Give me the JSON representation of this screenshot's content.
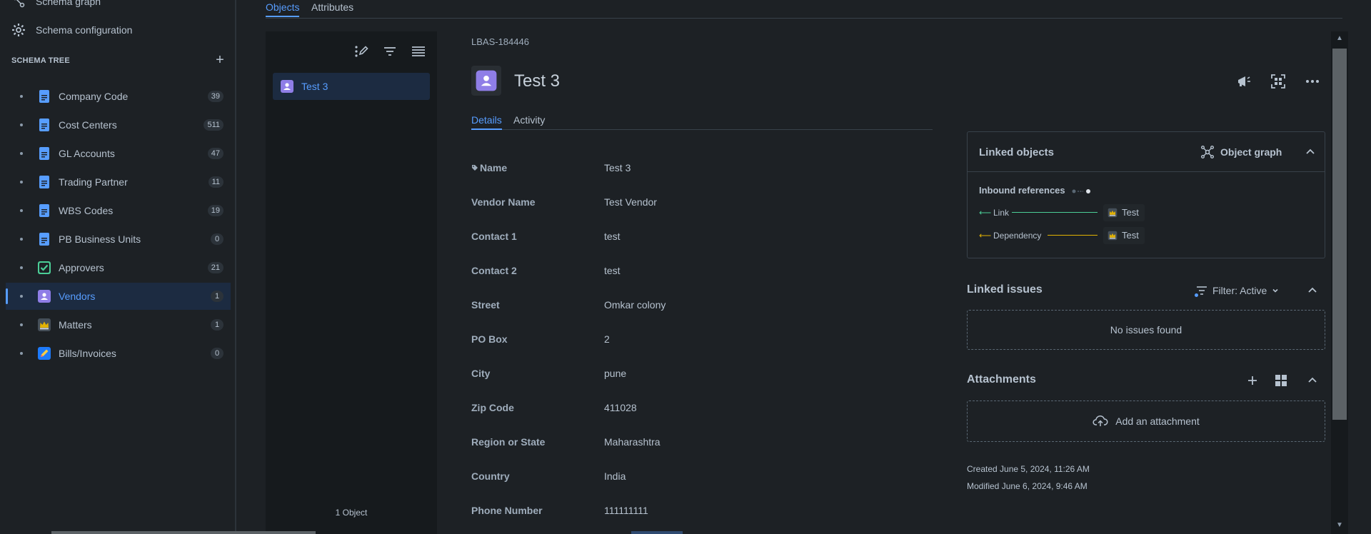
{
  "sidebar": {
    "top_item_partial": "Schema graph",
    "schema_config_label": "Schema configuration",
    "tree_header": "SCHEMA TREE",
    "items": [
      {
        "label": "Company Code",
        "count": "39",
        "icon": "document-icon",
        "color": "#579dff"
      },
      {
        "label": "Cost Centers",
        "count": "511",
        "icon": "document-icon",
        "color": "#579dff"
      },
      {
        "label": "GL Accounts",
        "count": "47",
        "icon": "document-icon",
        "color": "#579dff"
      },
      {
        "label": "Trading Partner",
        "count": "11",
        "icon": "document-icon",
        "color": "#579dff"
      },
      {
        "label": "WBS Codes",
        "count": "19",
        "icon": "document-icon",
        "color": "#579dff"
      },
      {
        "label": "PB Business Units",
        "count": "0",
        "icon": "document-icon",
        "color": "#579dff"
      },
      {
        "label": "Approvers",
        "count": "21",
        "icon": "checkbox-icon",
        "color": "#4bce97"
      },
      {
        "label": "Vendors",
        "count": "1",
        "icon": "person-icon",
        "color": "#8f7ee7"
      },
      {
        "label": "Matters",
        "count": "1",
        "icon": "crown-icon",
        "color": "#454f59"
      },
      {
        "label": "Bills/Invoices",
        "count": "0",
        "icon": "pencil-icon",
        "color": "#1d7afc"
      }
    ]
  },
  "top_tabs": {
    "objects": "Objects",
    "attributes": "Attributes"
  },
  "object_list": {
    "items": [
      {
        "label": "Test 3"
      }
    ],
    "footer": "1 Object"
  },
  "object": {
    "key": "LBAS-184446",
    "title": "Test 3",
    "tabs": {
      "details": "Details",
      "activity": "Activity"
    },
    "attributes": [
      {
        "label": "Name",
        "value": "Test 3"
      },
      {
        "label": "Vendor Name",
        "value": "Test Vendor"
      },
      {
        "label": "Contact 1",
        "value": "test"
      },
      {
        "label": "Contact 2",
        "value": "test"
      },
      {
        "label": "Street",
        "value": "Omkar colony"
      },
      {
        "label": "PO Box",
        "value": "2"
      },
      {
        "label": "City",
        "value": "pune"
      },
      {
        "label": "Zip Code",
        "value": "411028"
      },
      {
        "label": "Region or State",
        "value": "Maharashtra"
      },
      {
        "label": "Country",
        "value": "India"
      },
      {
        "label": "Phone Number",
        "value": "111111111"
      }
    ]
  },
  "linked_objects": {
    "title": "Linked objects",
    "graph_label": "Object graph",
    "inbound_label": "Inbound references",
    "refs": [
      {
        "type": "Link",
        "target": "Test",
        "color": "#4bce97"
      },
      {
        "type": "Dependency",
        "target": "Test",
        "color": "#e2b203"
      }
    ]
  },
  "linked_issues": {
    "title": "Linked issues",
    "filter_label": "Filter: Active",
    "empty": "No issues found"
  },
  "attachments": {
    "title": "Attachments",
    "add_label": "Add an attachment"
  },
  "meta": {
    "created": "Created June 5, 2024, 11:26 AM",
    "modified": "Modified June 6, 2024, 9:46 AM"
  }
}
